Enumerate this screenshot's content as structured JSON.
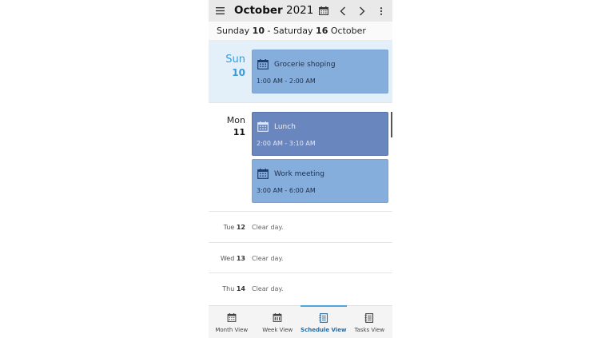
{
  "header": {
    "month": "October",
    "year": "2021"
  },
  "week_range": {
    "start_day": "Sunday",
    "start_num": "10",
    "separator": "-",
    "end_day": "Saturday",
    "end_num": "16",
    "end_month": "October"
  },
  "days": [
    {
      "name": "Sun",
      "num": "10",
      "events": [
        {
          "title": "Grocerie shoping",
          "time": "1:00 AM - 2:00 AM"
        }
      ]
    },
    {
      "name": "Mon",
      "num": "11",
      "events": [
        {
          "title": "Lunch",
          "time": "2:00 AM - 3:10 AM"
        },
        {
          "title": "Work meeting",
          "time": "3:00 AM - 6:00 AM"
        }
      ]
    }
  ],
  "clear_days": [
    {
      "name": "Tue",
      "num": "12",
      "text": "Clear day."
    },
    {
      "name": "Wed",
      "num": "13",
      "text": "Clear day."
    },
    {
      "name": "Thu",
      "num": "14",
      "text": "Clear day."
    }
  ],
  "bottom_nav": [
    {
      "label": "Month View",
      "icon": "month-view-icon"
    },
    {
      "label": "Week View",
      "icon": "week-view-icon"
    },
    {
      "label": "Schedule View",
      "icon": "schedule-view-icon",
      "active": true
    },
    {
      "label": "Tasks View",
      "icon": "tasks-view-icon"
    }
  ],
  "colors": {
    "today_bg": "#e3f0fa",
    "today_text": "#3a9bd5",
    "event_light": "#86aedd",
    "event_dark": "#6a86bf",
    "active_nav": "#4da6dd"
  }
}
